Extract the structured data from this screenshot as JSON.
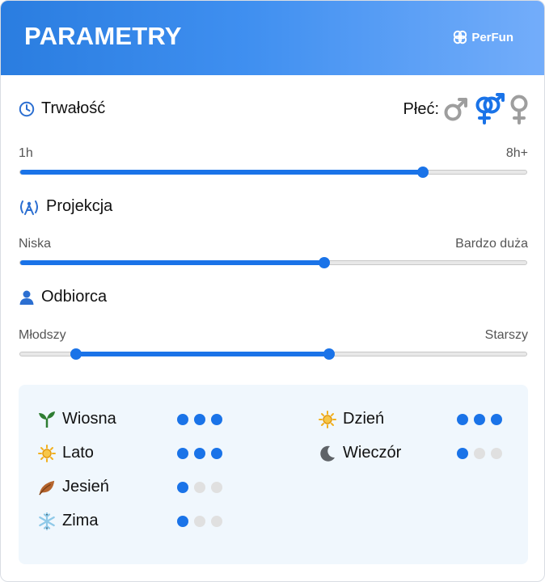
{
  "header": {
    "title": "PARAMETRY",
    "brand": "PerFun"
  },
  "gender": {
    "label": "Płeć:",
    "options": [
      "male-icon",
      "unisex-icon",
      "female-icon"
    ],
    "selected": "unisex"
  },
  "sliders": {
    "trwalosc": {
      "title": "Trwałość",
      "icon": "clock-icon",
      "min_label": "1h",
      "max_label": "8h+",
      "value": 0.795
    },
    "projekcja": {
      "title": "Projekcja",
      "icon": "broadcast-icon",
      "min_label": "Niska",
      "max_label": "Bardzo duża",
      "value": 0.6
    },
    "odbiorca": {
      "title": "Odbiorca",
      "icon": "person-icon",
      "min_label": "Młodszy",
      "max_label": "Starszy",
      "range": [
        0.11,
        0.611
      ]
    }
  },
  "seasons": [
    {
      "label": "Wiosna",
      "icon": "sprout-icon",
      "level": 3,
      "max": 3
    },
    {
      "label": "Lato",
      "icon": "sun-icon",
      "level": 3,
      "max": 3
    },
    {
      "label": "Jesień",
      "icon": "leaf-icon",
      "level": 1,
      "max": 3
    },
    {
      "label": "Zima",
      "icon": "snowflake-icon",
      "level": 1,
      "max": 3
    }
  ],
  "times": [
    {
      "label": "Dzień",
      "icon": "sun-icon",
      "level": 3,
      "max": 3
    },
    {
      "label": "Wieczór",
      "icon": "moon-icon",
      "level": 1,
      "max": 3
    }
  ],
  "colors": {
    "accent": "#1a73e8",
    "header_start": "#2a7de0",
    "header_end": "#73adfa",
    "inactive": "#e0e0e0",
    "gender_grey": "#9e9e9e"
  }
}
